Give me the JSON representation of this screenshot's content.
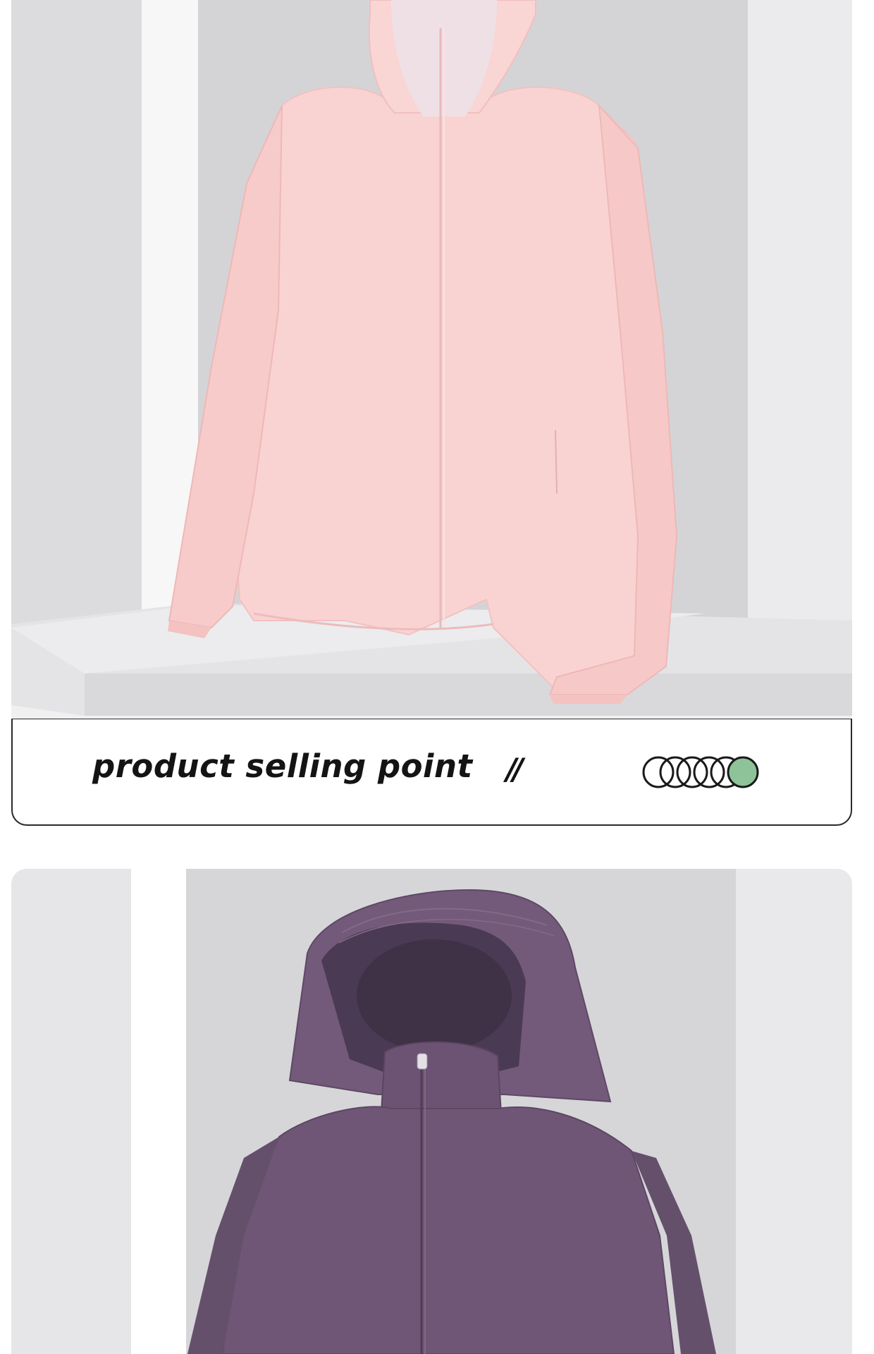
{
  "banner": {
    "title": "product selling point",
    "separator": "//",
    "progress": {
      "total": 6,
      "active_index": 5,
      "active_color": "#8ec39a"
    }
  },
  "images": [
    {
      "subject": "pink hooded sun-protection jacket on display stand",
      "color": "#f9d2d2"
    },
    {
      "subject": "purple hooded sun-protection jacket",
      "color": "#6e5474"
    }
  ]
}
